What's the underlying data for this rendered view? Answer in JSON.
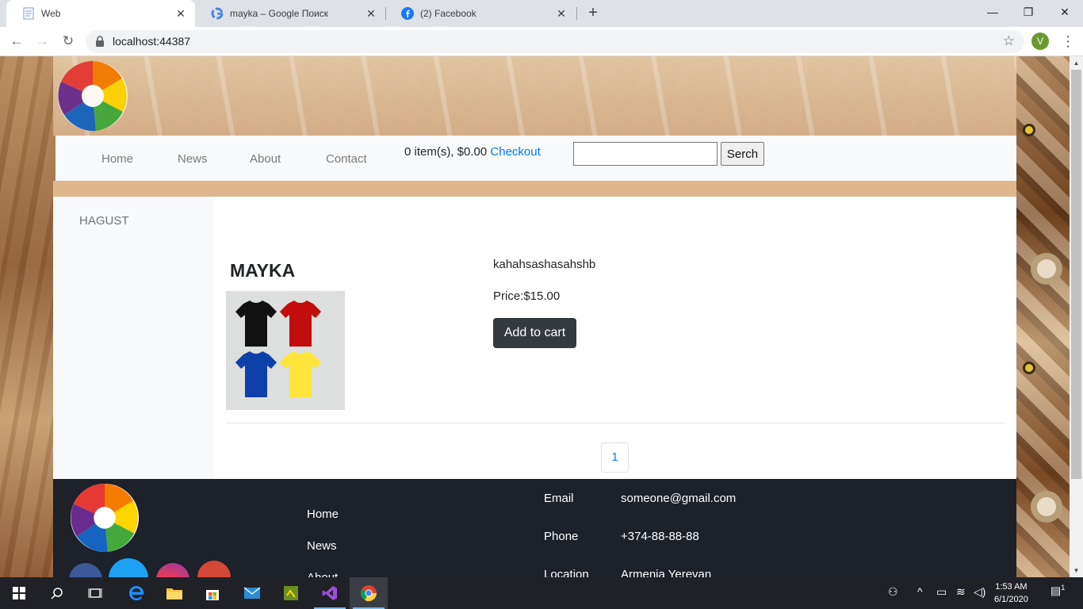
{
  "browser": {
    "tabs": [
      {
        "title": "Web",
        "icon": "page-icon",
        "active": true
      },
      {
        "title": "mayka – Google Поиск",
        "icon": "google-icon",
        "active": false
      },
      {
        "title": "(2) Facebook",
        "icon": "facebook-icon",
        "active": false
      }
    ],
    "url": "localhost:44387",
    "profile_initial": "V"
  },
  "site": {
    "nav": [
      "Home",
      "News",
      "About",
      "Contact"
    ],
    "cart": {
      "summary": "0 item(s), $0.00",
      "checkout": "Checkout"
    },
    "search": {
      "button": "Serch",
      "value": ""
    },
    "categories": [
      "HAGUST"
    ],
    "product": {
      "name": "MAYKA",
      "description": "kahahsashasahshb",
      "price": "Price:$15.00",
      "add_to_cart": "Add to cart"
    },
    "pagination": [
      "1"
    ],
    "footer": {
      "links": [
        "Home",
        "News",
        "About"
      ],
      "contact": [
        {
          "label": "Email",
          "value": "someone@gmail.com"
        },
        {
          "label": "Phone",
          "value": "+374-88-88-88"
        },
        {
          "label": "Location",
          "value": "Armenia Yerevan"
        }
      ],
      "social": [
        "facebook-icon",
        "twitter-icon",
        "instagram-icon",
        "google-plus-icon"
      ]
    }
  },
  "taskbar": {
    "time": "1:53 AM",
    "date": "6/1/2020",
    "notifications": "1"
  },
  "colors": {
    "accent_link": "#007bff",
    "button_dark": "#343a40",
    "footer_bg": "#1c212a"
  }
}
